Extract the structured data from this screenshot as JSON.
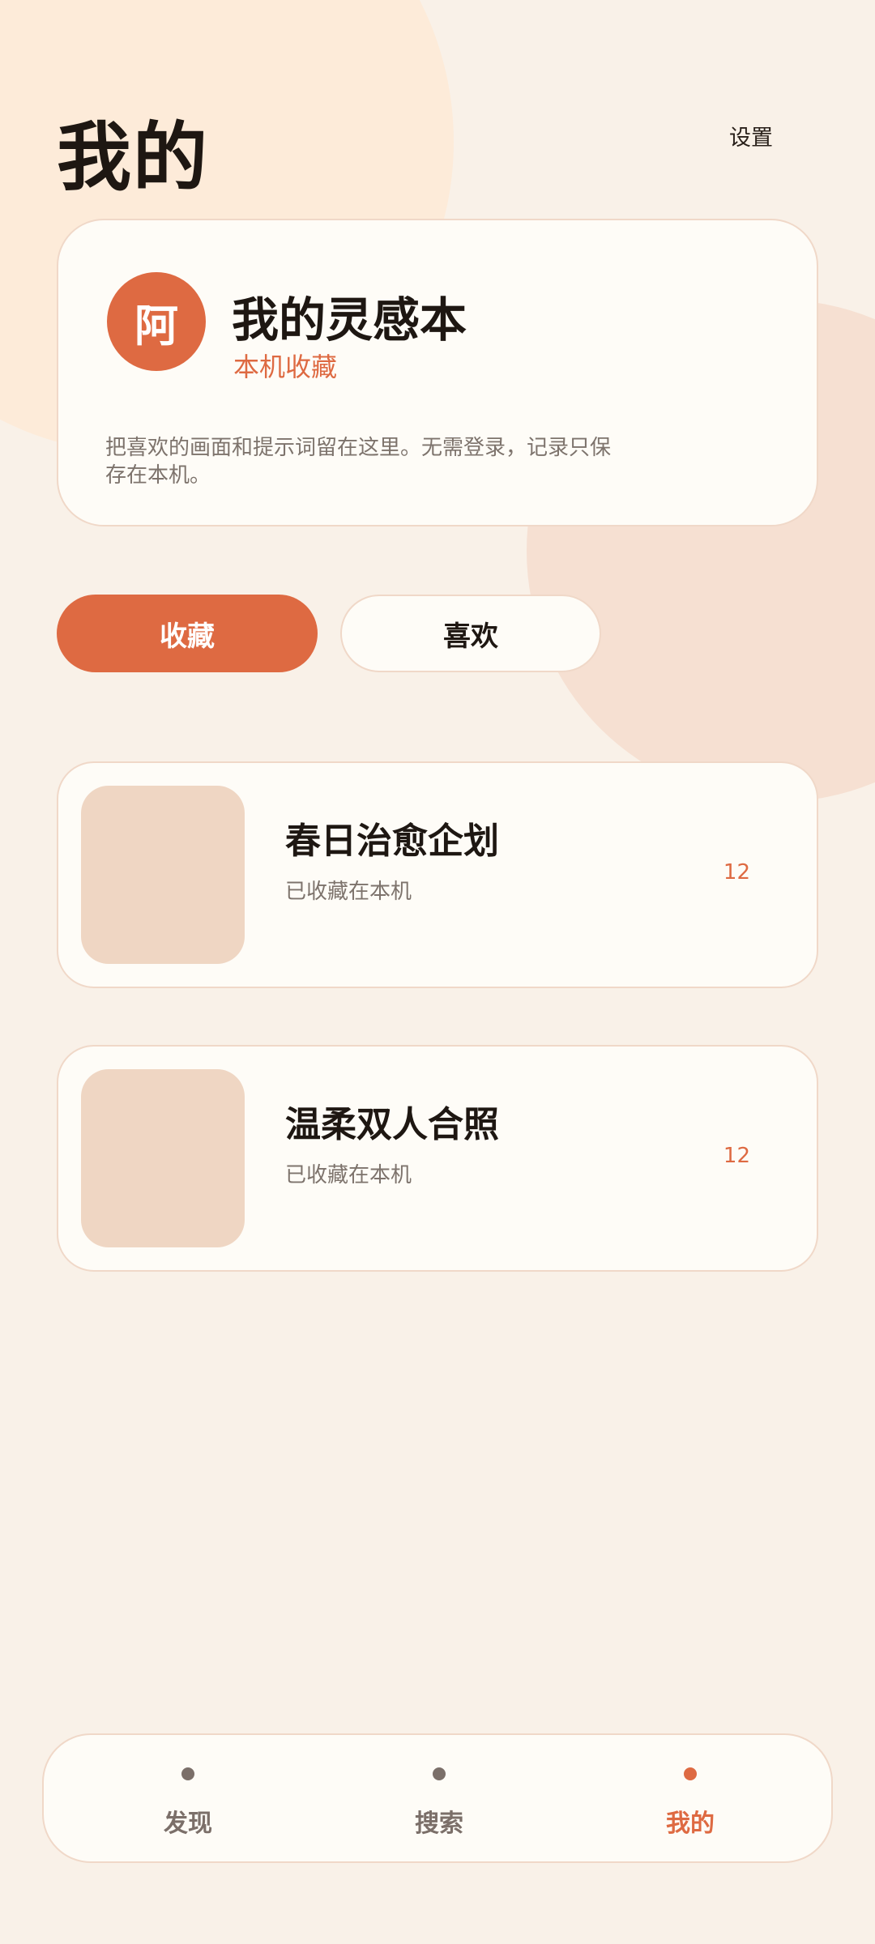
{
  "header": {
    "title": "我的",
    "settings_label": "设置"
  },
  "profile": {
    "avatar_text": "阿",
    "name": "我的灵感本",
    "subtitle": "本机收藏",
    "description": "把喜欢的画面和提示词留在这里。无需登录，记录只保存在本机。"
  },
  "tabs": [
    {
      "label": "收藏",
      "active": true
    },
    {
      "label": "喜欢",
      "active": false
    }
  ],
  "collections": [
    {
      "title": "春日治愈企划",
      "subtitle": "已收藏在本机",
      "count": "12"
    },
    {
      "title": "温柔双人合照",
      "subtitle": "已收藏在本机",
      "count": "12"
    }
  ],
  "bottom_nav": [
    {
      "label": "发现",
      "active": false
    },
    {
      "label": "搜索",
      "active": false
    },
    {
      "label": "我的",
      "active": true
    }
  ],
  "colors": {
    "accent": "#de6a42",
    "background": "#f9f1e8",
    "card": "#fefcf7",
    "thumbnail": "#efd6c3"
  }
}
